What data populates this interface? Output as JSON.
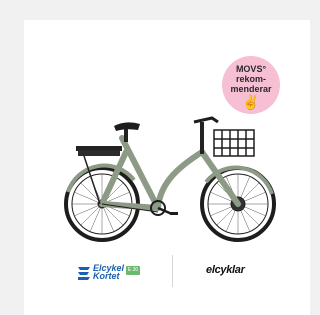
{
  "badge": {
    "line1": "MOVS°",
    "line2": "rekom-",
    "line3": "menderar",
    "hand_icon": "✌"
  },
  "brands": {
    "left_logo_line1": "Elcykel",
    "left_logo_line2": "Kortet",
    "left_logo_badge": "E.30",
    "right_logo": "elcyklar"
  },
  "colors": {
    "badge_bg": "#f6bfd4",
    "bike_frame": "#8c9a86",
    "elcykel_blue": "#1b5fb0",
    "elcykel_green": "#6cb86c"
  }
}
